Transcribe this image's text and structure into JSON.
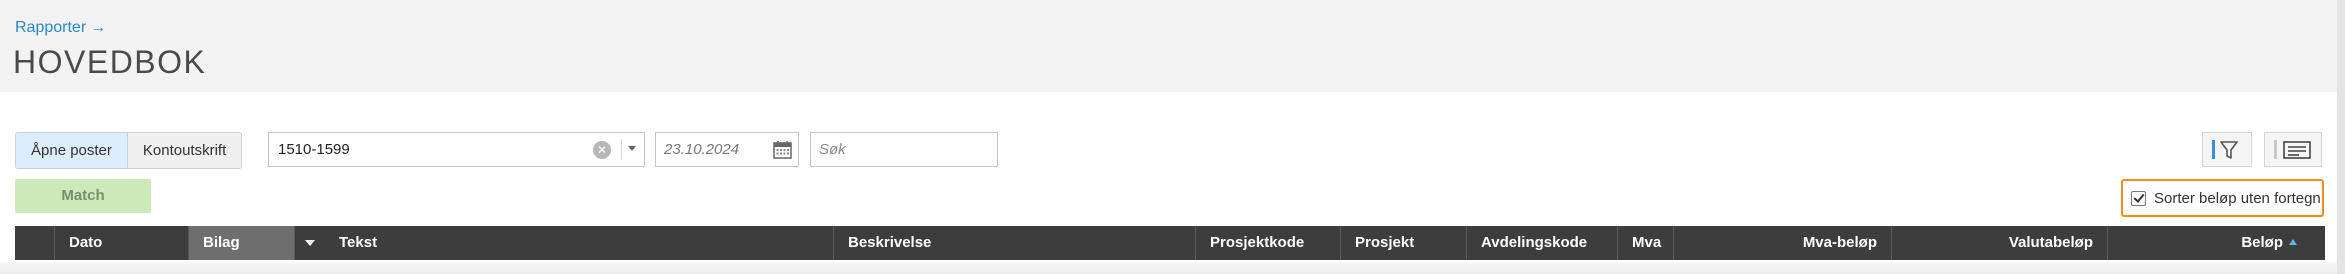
{
  "breadcrumb": {
    "label": "Rapporter",
    "arrow": "→"
  },
  "page": {
    "title": "HOVEDBOK"
  },
  "toolbar": {
    "tabs": [
      {
        "label": "Åpne poster",
        "active": true
      },
      {
        "label": "Kontoutskrift",
        "active": false
      }
    ],
    "account_range": {
      "value": "1510-1599"
    },
    "date": {
      "placeholder": "23.10.2024"
    },
    "search": {
      "placeholder": "Søk"
    },
    "icons": {
      "filter": "filter-icon",
      "columns": "columns-icon",
      "calendar": "calendar-icon",
      "clear": "clear-icon"
    }
  },
  "actions": {
    "match_label": "Match"
  },
  "options": {
    "sort_without_sign": {
      "label": "Sorter beløp uten fortegn",
      "checked": true
    }
  },
  "table": {
    "columns": [
      {
        "label": ""
      },
      {
        "label": "Dato"
      },
      {
        "label": "Bilag"
      },
      {
        "label": ""
      },
      {
        "label": "Tekst"
      },
      {
        "label": "Beskrivelse"
      },
      {
        "label": "Prosjektkode"
      },
      {
        "label": "Prosjekt"
      },
      {
        "label": "Avdelingskode"
      },
      {
        "label": "Mva"
      },
      {
        "label": "Mva-beløp"
      },
      {
        "label": "Valutabeløp"
      },
      {
        "label": "Beløp"
      }
    ],
    "sorted_column": "Beløp",
    "sort_direction": "ascending"
  },
  "colors": {
    "accent": "#2a88c8",
    "highlight": "#f28c1d",
    "match_bg": "#cde8b9",
    "header_bg": "#3d3d3d"
  }
}
